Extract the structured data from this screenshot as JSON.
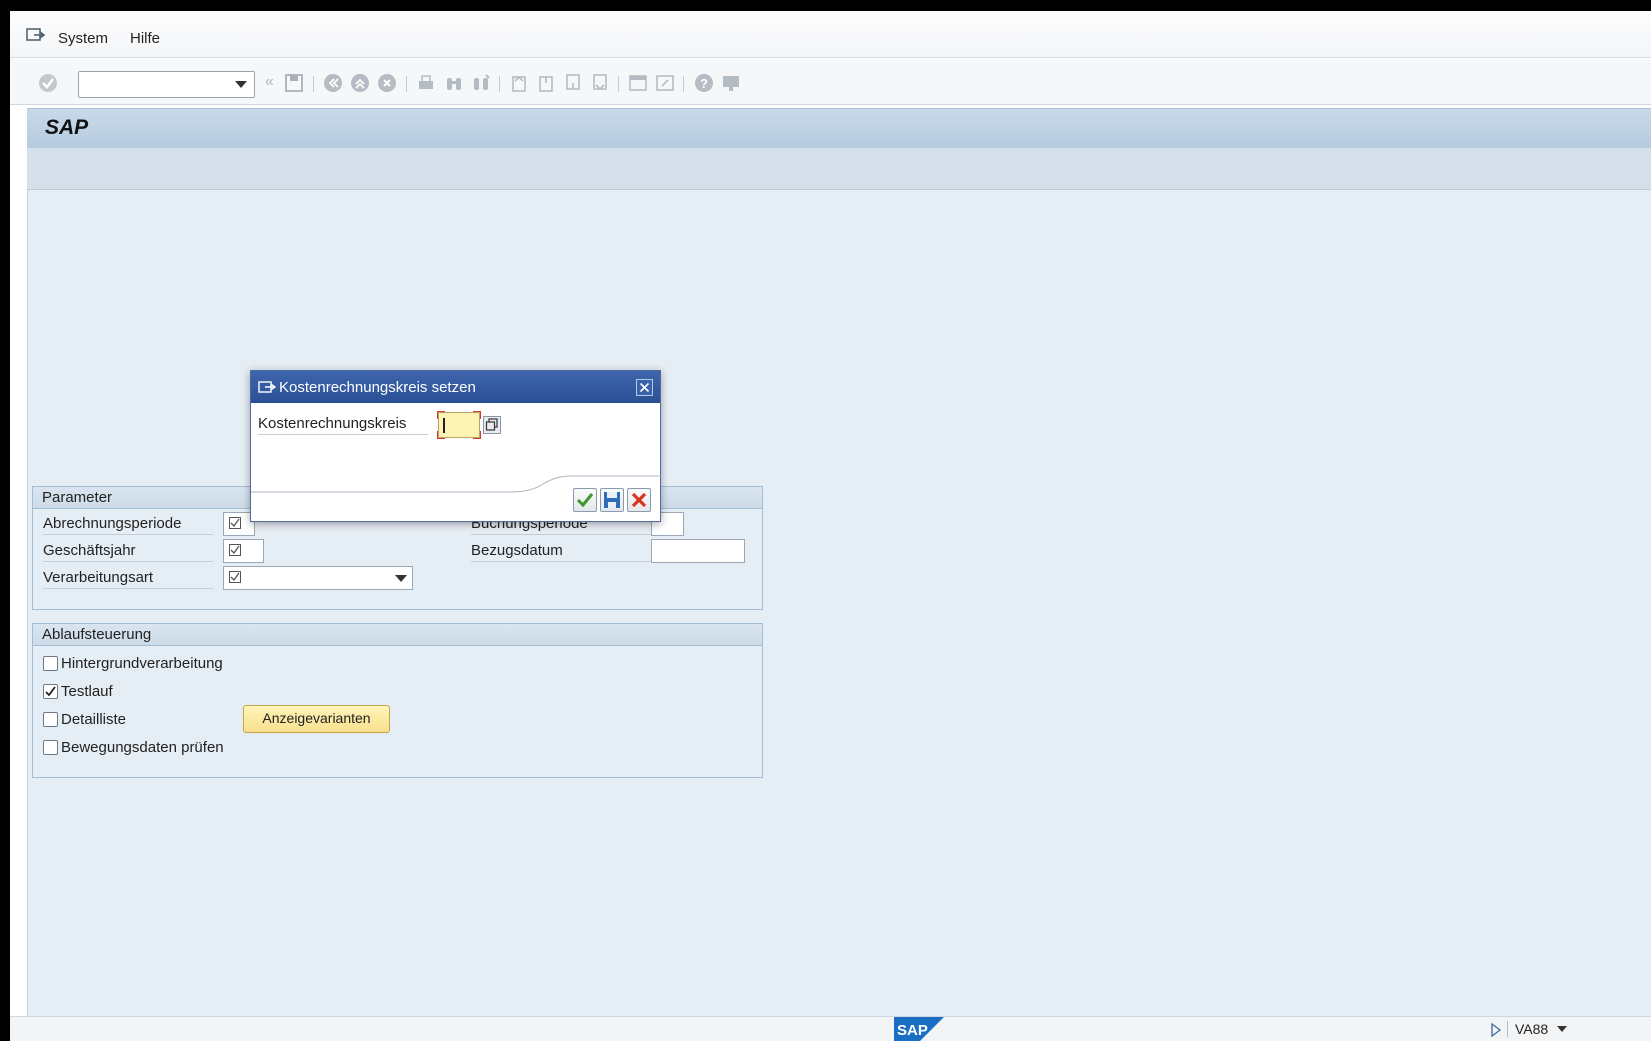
{
  "menu": {
    "items": [
      "System",
      "Hilfe"
    ]
  },
  "title": {
    "text": "SAP"
  },
  "dialog": {
    "title": "Kostenrechnungskreis setzen",
    "field_label": "Kostenrechnungskreis",
    "field_value": ""
  },
  "parameter": {
    "header": "Parameter",
    "abrechnungsperiode": "Abrechnungsperiode",
    "geschaeftsjahr": "Geschäftsjahr",
    "verarbeitungsart": "Verarbeitungsart",
    "buchungsperiode": "Buchungsperiode",
    "bezugsdatum": "Bezugsdatum"
  },
  "ablauf": {
    "header": "Ablaufsteuerung",
    "hintergrund": "Hintergrundverarbeitung",
    "testlauf": "Testlauf",
    "detailliste": "Detailliste",
    "bewegungsdaten": "Bewegungsdaten prüfen",
    "anzeigevarianten": "Anzeigevarianten",
    "testlauf_checked": true
  },
  "status": {
    "transaction": "VA88"
  },
  "colors": {
    "accent": "#2a4f96",
    "button_yellow": "#f8e08e"
  }
}
